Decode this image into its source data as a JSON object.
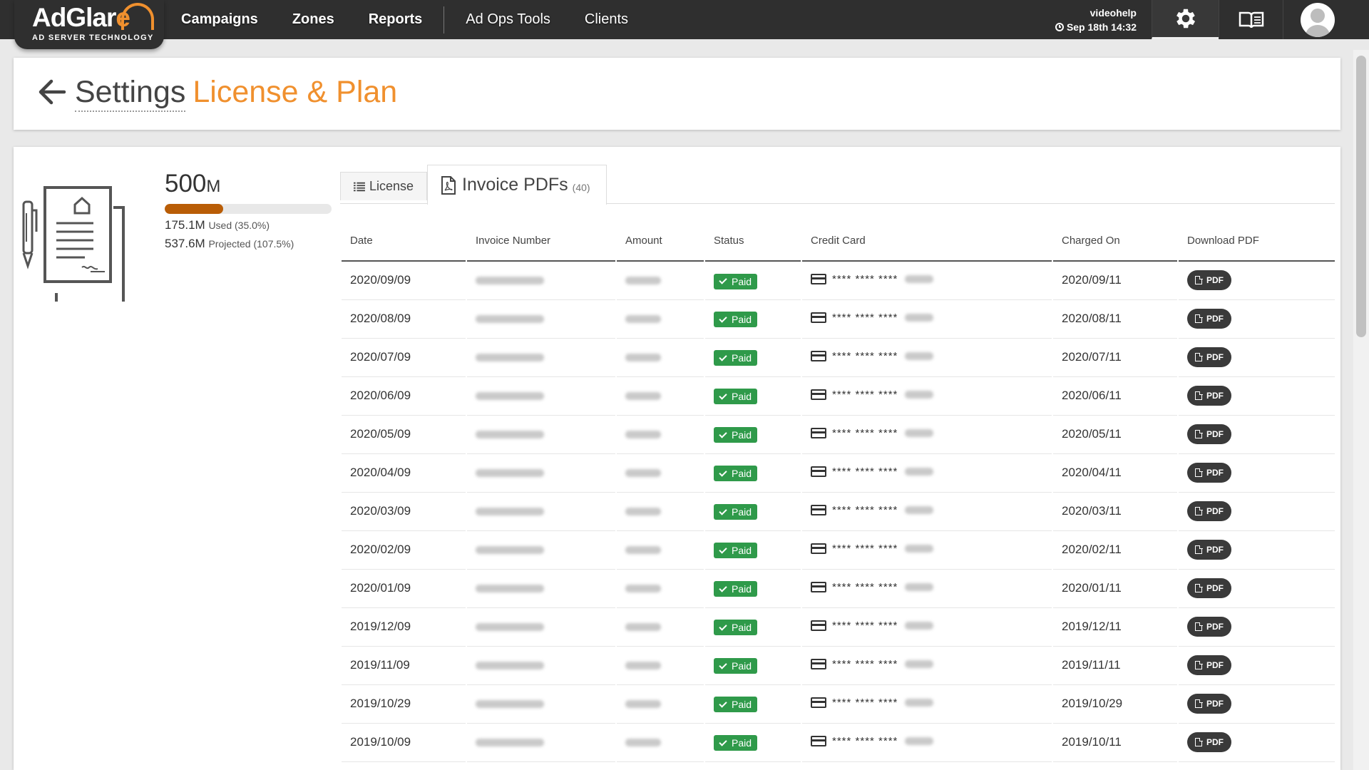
{
  "brand": {
    "name_part1": "AdGlar",
    "name_part2": "e",
    "tagline": "AD SERVER TECHNOLOGY"
  },
  "nav": [
    {
      "label": "Campaigns"
    },
    {
      "label": "Zones"
    },
    {
      "label": "Reports"
    },
    {
      "label": "Ad Ops Tools"
    },
    {
      "label": "Clients"
    }
  ],
  "user": {
    "name": "videohelp",
    "time": "Sep 18th 14:32"
  },
  "page": {
    "title": "Settings",
    "subtitle": "License & Plan"
  },
  "usage": {
    "plan_value": "500",
    "plan_unit": "M",
    "used_value": "175.1M",
    "used_label": "Used (35.0%)",
    "used_fraction": 0.35,
    "projected_value": "537.6M",
    "projected_label": "Projected (107.5%)"
  },
  "tabs": {
    "license": {
      "label": "License"
    },
    "invoices": {
      "label": "Invoice PDFs",
      "count": "(40)"
    }
  },
  "table": {
    "columns": [
      "Date",
      "Invoice Number",
      "Amount",
      "Status",
      "Credit Card",
      "Charged On",
      "Download PDF"
    ],
    "card_mask": "**** **** ****",
    "pdf_label": "PDF",
    "rows": [
      {
        "date": "2020/09/09",
        "status": "Paid",
        "charged_on": "2020/09/11"
      },
      {
        "date": "2020/08/09",
        "status": "Paid",
        "charged_on": "2020/08/11"
      },
      {
        "date": "2020/07/09",
        "status": "Paid",
        "charged_on": "2020/07/11"
      },
      {
        "date": "2020/06/09",
        "status": "Paid",
        "charged_on": "2020/06/11"
      },
      {
        "date": "2020/05/09",
        "status": "Paid",
        "charged_on": "2020/05/11"
      },
      {
        "date": "2020/04/09",
        "status": "Paid",
        "charged_on": "2020/04/11"
      },
      {
        "date": "2020/03/09",
        "status": "Paid",
        "charged_on": "2020/03/11"
      },
      {
        "date": "2020/02/09",
        "status": "Paid",
        "charged_on": "2020/02/11"
      },
      {
        "date": "2020/01/09",
        "status": "Paid",
        "charged_on": "2020/01/11"
      },
      {
        "date": "2019/12/09",
        "status": "Paid",
        "charged_on": "2019/12/11"
      },
      {
        "date": "2019/11/09",
        "status": "Paid",
        "charged_on": "2019/11/11"
      },
      {
        "date": "2019/10/29",
        "status": "Paid",
        "charged_on": "2019/10/29"
      },
      {
        "date": "2019/10/09",
        "status": "Paid",
        "charged_on": "2019/10/11"
      }
    ]
  }
}
